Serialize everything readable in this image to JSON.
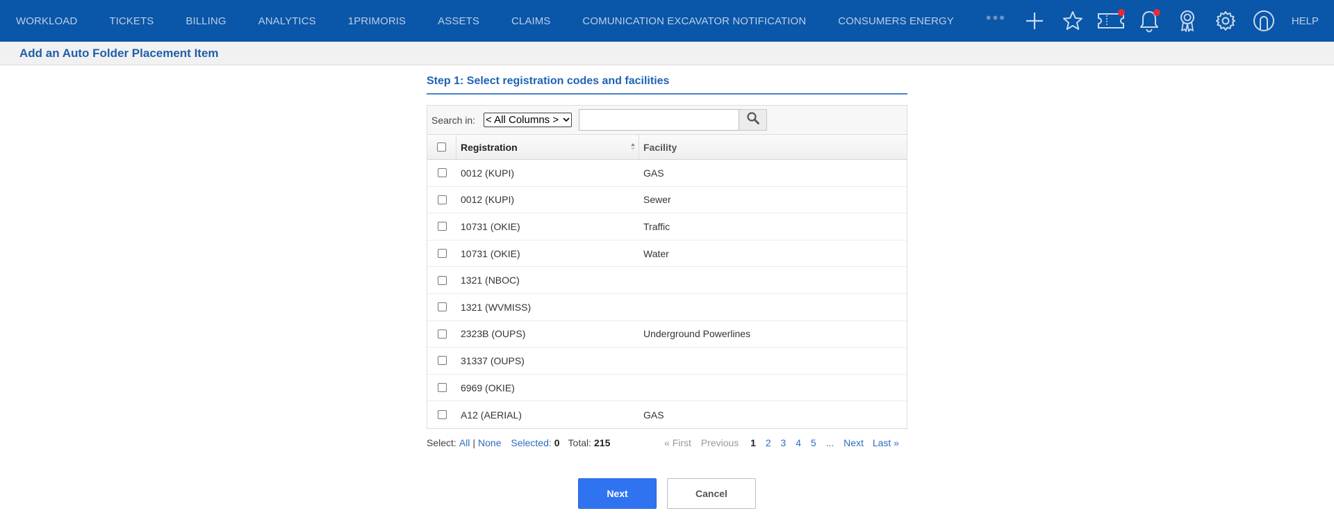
{
  "nav": {
    "items": [
      "WORKLOAD",
      "TICKETS",
      "BILLING",
      "ANALYTICS",
      "1PRIMORIS",
      "ASSETS",
      "CLAIMS",
      "COMUNICATION EXCAVATOR NOTIFICATION",
      "CONSUMERS ENERGY"
    ],
    "more_label": "•••",
    "help_label": "HELP",
    "icons": [
      "plus-icon",
      "star-icon",
      "ticket-icon",
      "bell-icon",
      "award-icon",
      "gear-icon",
      "user-icon"
    ],
    "badge_color": "#e8293a",
    "bar_color": "#0a56a8"
  },
  "page": {
    "title": "Add an Auto Folder Placement Item"
  },
  "step": {
    "title": "Step 1:  Select registration codes and facilities"
  },
  "search": {
    "label": "Search in:",
    "selected_option": "< All Columns >",
    "value": ""
  },
  "table": {
    "headers": {
      "registration": "Registration",
      "facility": "Facility"
    },
    "rows": [
      {
        "registration": "0012 (KUPI)",
        "facility": "GAS"
      },
      {
        "registration": "0012 (KUPI)",
        "facility": "Sewer"
      },
      {
        "registration": "10731 (OKIE)",
        "facility": "Traffic"
      },
      {
        "registration": "10731 (OKIE)",
        "facility": "Water"
      },
      {
        "registration": "1321 (NBOC)",
        "facility": ""
      },
      {
        "registration": "1321 (WVMISS)",
        "facility": ""
      },
      {
        "registration": "2323B (OUPS)",
        "facility": "Underground Powerlines"
      },
      {
        "registration": "31337 (OUPS)",
        "facility": ""
      },
      {
        "registration": "6969 (OKIE)",
        "facility": ""
      },
      {
        "registration": "A12 (AERIAL)",
        "facility": "GAS"
      }
    ]
  },
  "footer": {
    "select_label": "Select:",
    "all_label": "All",
    "separator": "|",
    "none_label": "None",
    "selected_label": "Selected:",
    "selected_count": "0",
    "total_label": "Total:",
    "total_count": "215",
    "pagination": {
      "first": "« First",
      "previous": "Previous",
      "pages": [
        "1",
        "2",
        "3",
        "4",
        "5"
      ],
      "current": "1",
      "ellipsis": "...",
      "next": "Next",
      "last": "Last »"
    }
  },
  "actions": {
    "next_label": "Next",
    "cancel_label": "Cancel",
    "primary_color": "#2f73f1"
  }
}
